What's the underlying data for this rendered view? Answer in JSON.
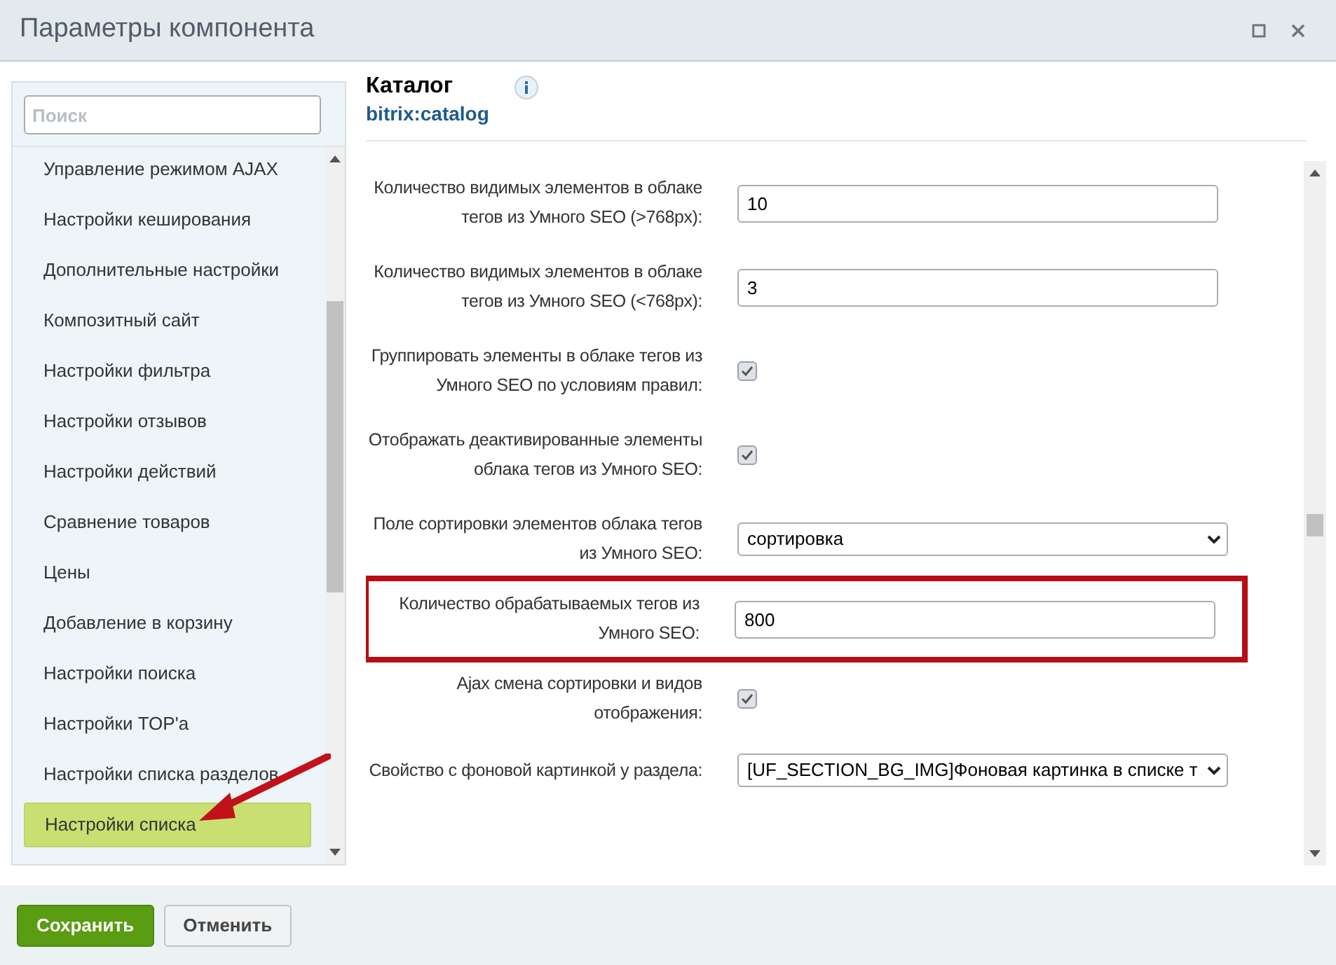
{
  "window": {
    "title": "Параметры компонента"
  },
  "sidebar": {
    "search": {
      "placeholder": "Поиск"
    },
    "items": [
      {
        "label": "Управление режимом AJAX",
        "selected": false
      },
      {
        "label": "Настройки кеширования",
        "selected": false
      },
      {
        "label": "Дополнительные настройки",
        "selected": false
      },
      {
        "label": "Композитный сайт",
        "selected": false
      },
      {
        "label": "Настройки фильтра",
        "selected": false
      },
      {
        "label": "Настройки отзывов",
        "selected": false
      },
      {
        "label": "Настройки действий",
        "selected": false
      },
      {
        "label": "Сравнение товаров",
        "selected": false
      },
      {
        "label": "Цены",
        "selected": false
      },
      {
        "label": "Добавление в корзину",
        "selected": false
      },
      {
        "label": "Настройки поиска",
        "selected": false
      },
      {
        "label": "Настройки TOP'а",
        "selected": false
      },
      {
        "label": "Настройки списка разделов",
        "selected": false
      },
      {
        "label": "Настройки списка",
        "selected": true
      }
    ]
  },
  "component": {
    "title": "Каталог",
    "code": "bitrix:catalog"
  },
  "fields": [
    {
      "kind": "text",
      "label": "Количество видимых элементов в облаке тегов из Умного SEO (>768px):",
      "value": "10",
      "highlighted": false
    },
    {
      "kind": "text",
      "label": "Количество видимых элементов в облаке тегов из Умного SEO (<768px):",
      "value": "3",
      "highlighted": false
    },
    {
      "kind": "checkbox",
      "label": "Группировать элементы в облаке тегов из Умного SEO по условиям правил:",
      "checked": true,
      "highlighted": false
    },
    {
      "kind": "checkbox",
      "label": "Отображать деактивированные элементы облака тегов из Умного SEO:",
      "checked": true,
      "highlighted": false
    },
    {
      "kind": "select",
      "label": "Поле сортировки элементов облака тегов из Умного SEO:",
      "value": "сортировка",
      "highlighted": false
    },
    {
      "kind": "text",
      "label": "Количество обрабатываемых тегов из Умного SEO:",
      "value": "800",
      "highlighted": true
    },
    {
      "kind": "checkbox",
      "label": "Ajax смена сортировки и видов отображения:",
      "checked": true,
      "highlighted": false
    },
    {
      "kind": "select",
      "label": "Свойство с фоновой картинкой у раздела:",
      "value": "[UF_SECTION_BG_IMG]Фоновая картинка в списке т",
      "highlighted": false
    }
  ],
  "buttons": [
    {
      "kind": "primary",
      "label": "Сохранить"
    },
    {
      "kind": "secondary",
      "label": "Отменить"
    }
  ]
}
